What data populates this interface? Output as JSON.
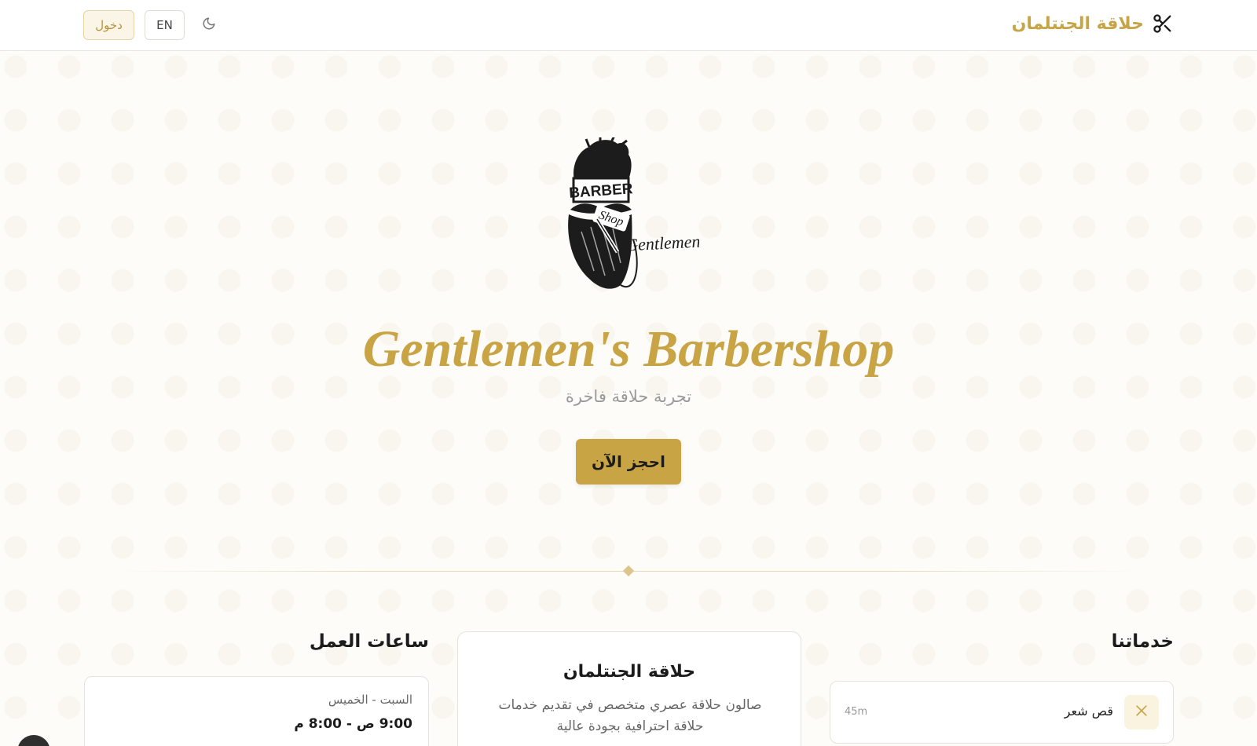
{
  "header": {
    "brand_name": "حلاقة الجنتلمان",
    "brand_icon": "scissors-icon",
    "login_label": "دخول",
    "lang_label": "EN",
    "theme_icon": "moon-icon"
  },
  "hero": {
    "logo_text": {
      "top": "BARBER",
      "middle": "Shop",
      "script": "Gentlemen"
    },
    "title": "Gentlemen's Barbershop",
    "subtitle": "تجربة حلاقة فاخرة",
    "cta_label": "احجز الآن"
  },
  "hours": {
    "title": "ساعات العمل",
    "days": "السبت - الخميس",
    "time": "9:00 ص - 8:00 م"
  },
  "about": {
    "title": "حلاقة الجنتلمان",
    "description": "صالون حلاقة عصري متخصص في تقديم خدمات حلاقة احترافية بجودة عالية"
  },
  "services": {
    "title": "خدماتنا",
    "items": [
      {
        "name": "قص شعر",
        "duration": "45m",
        "icon": "scissors-icon"
      }
    ]
  },
  "colors": {
    "accent": "#c9a445",
    "accent_light": "#faf3df",
    "text": "#1c1c1c",
    "muted": "#9a9a9a",
    "background": "#fdfcf9"
  }
}
